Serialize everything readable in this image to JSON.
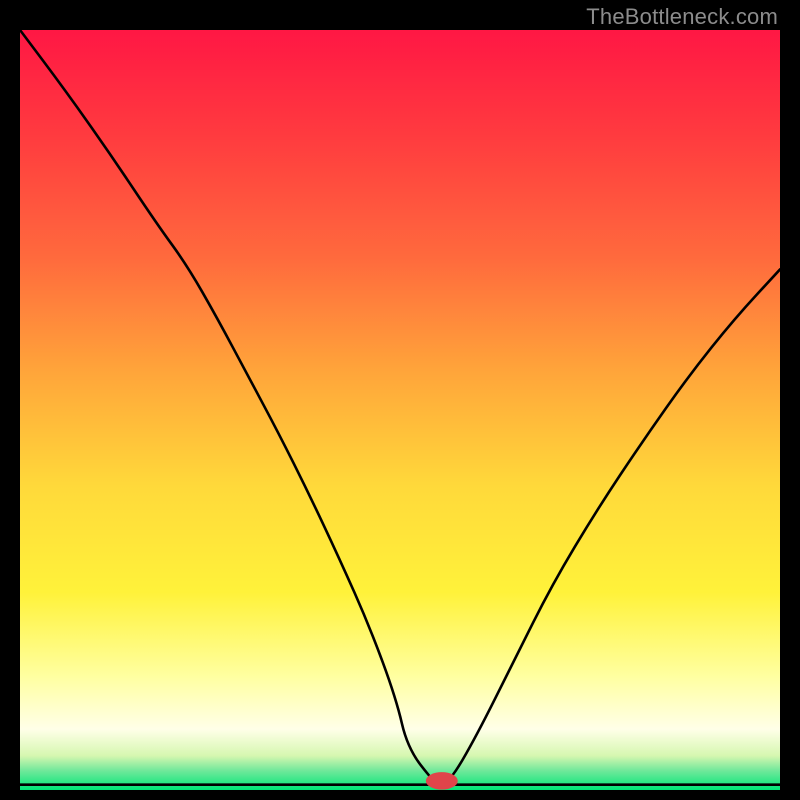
{
  "watermark": "TheBottleneck.com",
  "chart_data": {
    "type": "line",
    "title": "",
    "xlabel": "",
    "ylabel": "",
    "xlim": [
      0,
      100
    ],
    "ylim": [
      0,
      100
    ],
    "grid": false,
    "legend": false,
    "background_gradient_stops": [
      {
        "offset": 0.0,
        "color": "#ff1744"
      },
      {
        "offset": 0.14,
        "color": "#ff3b3f"
      },
      {
        "offset": 0.3,
        "color": "#ff6a3d"
      },
      {
        "offset": 0.45,
        "color": "#ffa53a"
      },
      {
        "offset": 0.6,
        "color": "#ffd93a"
      },
      {
        "offset": 0.74,
        "color": "#fff23a"
      },
      {
        "offset": 0.85,
        "color": "#ffffa0"
      },
      {
        "offset": 0.92,
        "color": "#ffffe8"
      },
      {
        "offset": 0.955,
        "color": "#d6f7b0"
      },
      {
        "offset": 0.975,
        "color": "#6ee89a"
      },
      {
        "offset": 1.0,
        "color": "#00e676"
      }
    ],
    "series": [
      {
        "name": "bottleneck-curve",
        "line_color": "#000000",
        "line_width": 2.6,
        "x": [
          0,
          6,
          12,
          18,
          22,
          26,
          30,
          34,
          38,
          42,
          46,
          49.5,
          51,
          54.5,
          55,
          56.5,
          60,
          65,
          70,
          76,
          82,
          88,
          94,
          100
        ],
        "y": [
          100,
          92,
          83.5,
          74.5,
          69,
          62,
          54.5,
          47,
          39,
          30.5,
          21.5,
          12,
          5.5,
          1.0,
          1.0,
          1.0,
          7,
          17,
          27,
          37,
          46,
          54.5,
          62,
          68.5
        ]
      }
    ],
    "marker": {
      "name": "optimal-point",
      "x": 55.5,
      "y": 1.2,
      "rx": 2.1,
      "ry": 1.15,
      "fill": "#e0444a"
    },
    "baseline": {
      "name": "zero-line",
      "y": 0.7,
      "color": "#000000",
      "width": 2.6
    }
  }
}
